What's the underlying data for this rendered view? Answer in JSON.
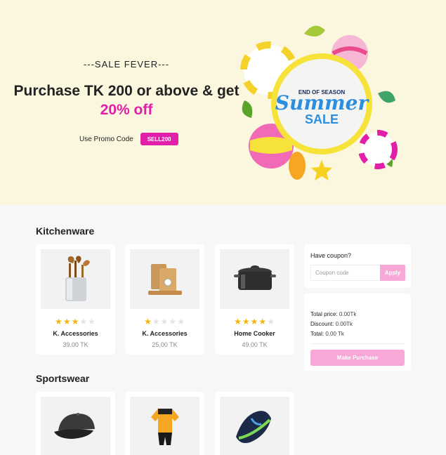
{
  "hero": {
    "eyebrow": "---SALE FEVER---",
    "headline_main": "Purchase TK 200 or above & get",
    "headline_accent": "20% off",
    "promo_label": "Use Promo Code",
    "promo_code": "SELL200",
    "art_top_text": "END OF SEASON",
    "art_script_text": "Summer",
    "art_bottom_text": "SALE"
  },
  "sections": [
    {
      "title": "Kitchenware",
      "items": [
        {
          "name": "K. Accessories",
          "price": "39.00 TK",
          "rating": 3,
          "icon": "utensil-holder-icon"
        },
        {
          "name": "K. Accessories",
          "price": "25.00 TK",
          "rating": 1,
          "icon": "cutting-board-icon"
        },
        {
          "name": "Home Cooker",
          "price": "49.00 TK",
          "rating": 4,
          "icon": "cooking-pot-icon"
        }
      ]
    },
    {
      "title": "Sportswear",
      "items": [
        {
          "name": "",
          "price": "",
          "rating": 0,
          "icon": "cap-icon"
        },
        {
          "name": "",
          "price": "",
          "rating": 0,
          "icon": "cycling-suit-icon"
        },
        {
          "name": "",
          "price": "",
          "rating": 0,
          "icon": "sneaker-icon"
        }
      ]
    }
  ],
  "coupon": {
    "title": "Have coupon?",
    "placeholder": "Coupon code",
    "apply_label": "Apply"
  },
  "summary": {
    "total_price_label": "Total price:",
    "total_price_value": "0.00Tk",
    "discount_label": "Discount:",
    "discount_value": "0.00Tk",
    "total_label": "Total:",
    "total_value": "0.00 Tk",
    "purchase_label": "Make Purchase"
  },
  "colors": {
    "accent": "#e21fa9",
    "hero_bg": "#fbf7df",
    "button_pink": "#f7a8d6",
    "star": "#f5b50a"
  }
}
